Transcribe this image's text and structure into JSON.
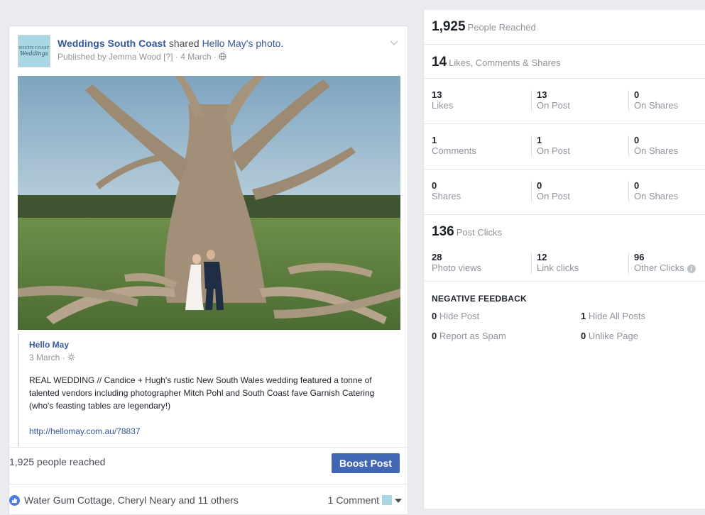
{
  "post": {
    "page_name": "Weddings South Coast",
    "shared_word": " shared ",
    "shared_from": "Hello May",
    "photo_word": "'s photo.",
    "byline": "Published by Jemma Wood [?] · 4 March ·",
    "avatar_line1": "SOUTH COAST",
    "avatar_line2": "Weddings",
    "shared_name": "Hello May",
    "shared_date": "3 March ·",
    "shared_text": "REAL WEDDING // Candice + Hugh's rustic New South Wales wedding featured a tonne of talented vendors including photographer Mitch Pohl and South Coast fave Garnish Catering (who's feasting tables are legendary!)",
    "shared_url": "http://hellomay.com.au/78837",
    "reached": "1,925 people reached",
    "boost_label": "Boost Post",
    "likers": "Water Gum Cottage, Cheryl Neary and 11 others",
    "comments": "1 Comment"
  },
  "stats": {
    "reach": {
      "value": "1,925",
      "label": "People Reached"
    },
    "engagement": {
      "value": "14",
      "label": "Likes, Comments & Shares"
    },
    "rows": [
      {
        "a_val": "13",
        "a_lbl": "Likes",
        "b_val": "13",
        "b_lbl": "On Post",
        "c_val": "0",
        "c_lbl": "On Shares"
      },
      {
        "a_val": "1",
        "a_lbl": "Comments",
        "b_val": "1",
        "b_lbl": "On Post",
        "c_val": "0",
        "c_lbl": "On Shares"
      },
      {
        "a_val": "0",
        "a_lbl": "Shares",
        "b_val": "0",
        "b_lbl": "On Post",
        "c_val": "0",
        "c_lbl": "On Shares"
      }
    ],
    "clicks": {
      "value": "136",
      "label": "Post Clicks"
    },
    "click_row": {
      "a_val": "28",
      "a_lbl": "Photo views",
      "b_val": "12",
      "b_lbl": "Link clicks",
      "c_val": "96",
      "c_lbl": "Other Clicks"
    },
    "negative": {
      "heading": "NEGATIVE FEEDBACK",
      "hide_post_val": "0",
      "hide_post_lbl": "Hide Post",
      "hide_all_val": "1",
      "hide_all_lbl": "Hide All Posts",
      "spam_val": "0",
      "spam_lbl": "Report as Spam",
      "unlike_val": "0",
      "unlike_lbl": "Unlike Page"
    }
  },
  "colors": {
    "link": "#365899",
    "boost": "#4267b2",
    "muted": "#90949c"
  },
  "icons": [
    "chevron-down-icon",
    "globe-icon",
    "gear-icon",
    "like-icon",
    "info-icon",
    "caret-down-icon"
  ]
}
